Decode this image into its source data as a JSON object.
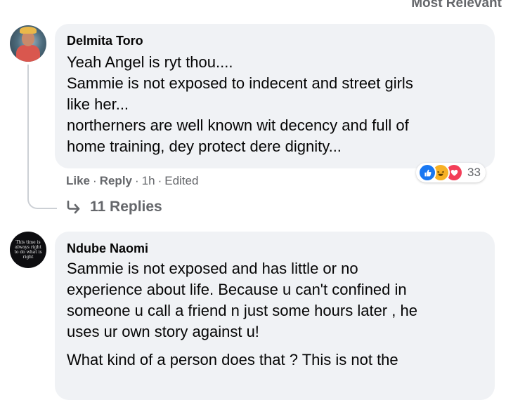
{
  "sort_label": "Most Relevant",
  "comments": [
    {
      "author": "Delmita Toro",
      "lines": [
        "Yeah Angel is ryt thou....",
        "Sammie is not exposed to indecent and street girls",
        "like her...",
        "northerners are well known wit decency and full of",
        "home training, dey protect dere dignity..."
      ],
      "actions": {
        "like": "Like",
        "reply": "Reply",
        "time": "1h",
        "edited": "Edited"
      },
      "reactions": {
        "icons": [
          "like-icon",
          "haha-icon",
          "love-icon"
        ],
        "count": "33"
      },
      "replies_label": "11 Replies",
      "avatar_icon": "profile-photo"
    },
    {
      "author": "Ndube Naomi",
      "avatar_text": "This time is always right to do what is right",
      "lines": [
        "Sammie is not exposed and has little or no",
        "experience about life. Because u can't confined in",
        "someone u call a friend n just some hours later , he",
        "uses ur own story against u!"
      ],
      "lines2": [
        "What kind of a person does that ? This is not the"
      ]
    }
  ],
  "colors": {
    "bubble": "#f0f2f5",
    "meta": "#65676b",
    "like": "#1877f2",
    "haha": "#f7b125",
    "love": "#f33e58"
  }
}
